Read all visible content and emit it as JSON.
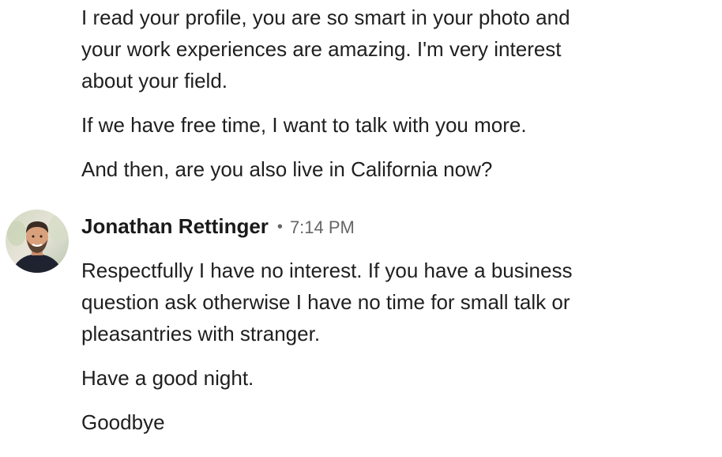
{
  "previous_message": {
    "paragraphs": [
      {
        "lines": [
          "I read your profile, you are so smart in your photo and",
          "your work experiences are amazing. I'm very interest",
          "about your field."
        ]
      },
      {
        "lines": [
          "If we have free time, I want to talk with you more."
        ]
      },
      {
        "lines": [
          "And then, are you also live in California now?"
        ]
      }
    ]
  },
  "reply": {
    "sender_name": "Jonathan Rettinger",
    "separator": "•",
    "timestamp": "7:14 PM",
    "avatar_icon": "profile-photo",
    "paragraphs": [
      {
        "lines": [
          "Respectfully I have no interest. If you have a business",
          "question ask otherwise I have no time for small talk or",
          "pleasantries with stranger."
        ]
      },
      {
        "lines": [
          "Have a good night."
        ]
      },
      {
        "lines": [
          "Goodbye"
        ]
      }
    ]
  }
}
